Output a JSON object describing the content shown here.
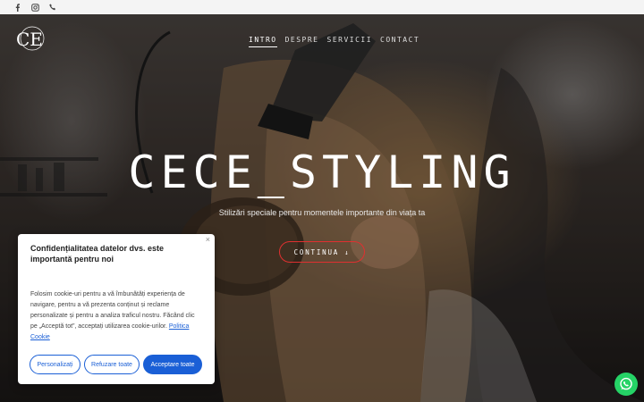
{
  "topbar": {
    "icons": [
      "facebook-icon",
      "instagram-icon",
      "phone-icon"
    ]
  },
  "logo": {
    "text": "CE"
  },
  "nav": {
    "items": [
      "INTRO",
      "DESPRE",
      "SERVICII",
      "CONTACT"
    ],
    "active": "INTRO"
  },
  "hero": {
    "title": "CECE_STYLING",
    "subtitle": "Stilizări speciale pentru momentele importante din viața ta",
    "cta_label": "CONTINUA",
    "cta_arrow": "↓"
  },
  "cookie": {
    "close": "×",
    "heading": "Confidențialitatea datelor dvs. este importantă pentru noi",
    "body": "Folosim cookie-uri pentru a vă îmbunătăți experiența de navigare, pentru a vă prezenta conținut și reclame personalizate și pentru a analiza traficul nostru. Făcând clic pe „Acceptă tot”, acceptați utilizarea cookie-urilor.",
    "policy_link": "Politica Cookie",
    "btn_customize": "Personalizați",
    "btn_reject": "Refuzare toate",
    "btn_accept": "Acceptare toate"
  },
  "colors": {
    "accent_blue": "#1a5fd6",
    "cta_border": "#e03030",
    "whatsapp": "#25d366"
  }
}
